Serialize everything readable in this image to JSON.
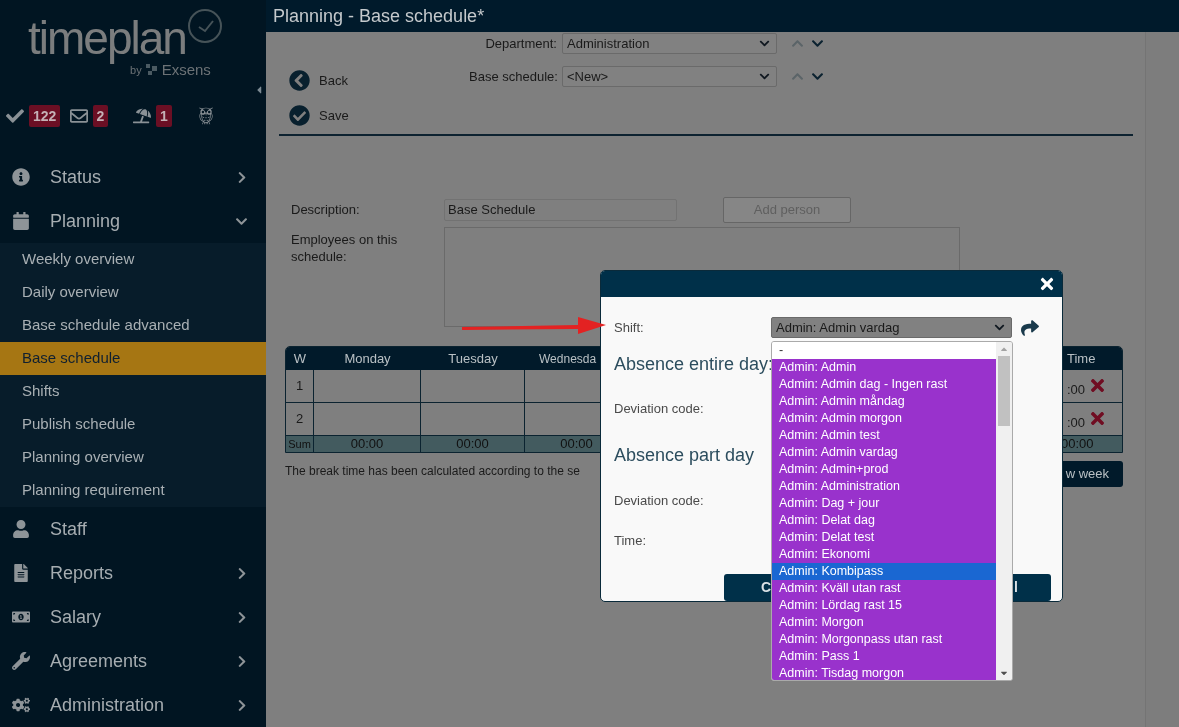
{
  "sidebar": {
    "logo": {
      "name": "timeplan",
      "byline": "by",
      "brand": "Exsens"
    },
    "badges": [
      {
        "kind": "tasks",
        "count": "122"
      },
      {
        "kind": "messages",
        "count": "2"
      },
      {
        "kind": "vacation",
        "count": "1"
      },
      {
        "kind": "owl"
      }
    ],
    "menu": [
      {
        "kind": "status",
        "label": "Status",
        "expanded": false
      },
      {
        "kind": "planning",
        "label": "Planning",
        "expanded": true,
        "children": [
          {
            "label": "Weekly overview",
            "selected": false
          },
          {
            "label": "Daily overview",
            "selected": false
          },
          {
            "label": "Base schedule advanced",
            "selected": false
          },
          {
            "label": "Base schedule",
            "selected": true
          },
          {
            "label": "Shifts",
            "selected": false
          },
          {
            "label": "Publish schedule",
            "selected": false
          },
          {
            "label": "Planning overview",
            "selected": false
          },
          {
            "label": "Planning requirement",
            "selected": false
          }
        ]
      },
      {
        "kind": "staff",
        "label": "Staff"
      },
      {
        "kind": "reports",
        "label": "Reports",
        "expanded": false
      },
      {
        "kind": "salary",
        "label": "Salary",
        "expanded": false
      },
      {
        "kind": "agreements",
        "label": "Agreements",
        "expanded": false
      },
      {
        "kind": "administration",
        "label": "Administration",
        "expanded": false
      }
    ]
  },
  "page_title": "Planning - Base schedule*",
  "filters": [
    {
      "label": "Department:",
      "value": "Administration"
    },
    {
      "label": "Base schedule:",
      "value": "<New>"
    }
  ],
  "actions": [
    {
      "kind": "back",
      "label": "Back"
    },
    {
      "kind": "save",
      "label": "Save"
    }
  ],
  "form": {
    "description_label": "Description:",
    "description_value": "Base Schedule",
    "add_person": {
      "label": "Add person",
      "disabled": true
    },
    "employees_label": "Employees on this schedule:"
  },
  "schedule_table": {
    "columns": [
      "W",
      "Monday",
      "Tuesday",
      "Wednesda"
    ],
    "time_column": "Time",
    "rows": [
      {
        "week": "1",
        "time": ":00"
      },
      {
        "week": "2",
        "time": ":00"
      }
    ],
    "sum": {
      "label": "Sum",
      "values": [
        "00:00",
        "00:00",
        "00:00"
      ],
      "time": "00:00"
    }
  },
  "note": "The break time has been calculated according to the se",
  "new_week_button": "w week",
  "dialog": {
    "shift_label": "Shift:",
    "shift_value": "Admin: Admin vardag",
    "absence_entire_day": "Absence entire day:",
    "deviation_code_1": "Deviation code:",
    "absence_part_day": "Absence part day",
    "deviation_code_2": "Deviation code:",
    "time_label": "Time:",
    "buttons": [
      "C",
      "l"
    ],
    "options": [
      {
        "label": "-",
        "selected": false
      },
      {
        "label": "Admin: Admin",
        "selected": false
      },
      {
        "label": "Admin: Admin dag - Ingen rast",
        "selected": false
      },
      {
        "label": "Admin: Admin måndag",
        "selected": false
      },
      {
        "label": "Admin: Admin morgon",
        "selected": false
      },
      {
        "label": "Admin: Admin test",
        "selected": false
      },
      {
        "label": "Admin: Admin vardag",
        "selected": false
      },
      {
        "label": "Admin: Admin+prod",
        "selected": false
      },
      {
        "label": "Admin: Administration",
        "selected": false
      },
      {
        "label": "Admin: Dag + jour",
        "selected": false
      },
      {
        "label": "Admin: Delat dag",
        "selected": false
      },
      {
        "label": "Admin: Delat test",
        "selected": false
      },
      {
        "label": "Admin: Ekonomi",
        "selected": false
      },
      {
        "label": "Admin: Kombipass",
        "selected": true
      },
      {
        "label": "Admin: Kväll utan rast",
        "selected": false
      },
      {
        "label": "Admin: Lördag rast 15",
        "selected": false
      },
      {
        "label": "Admin: Morgon",
        "selected": false
      },
      {
        "label": "Admin: Morgonpass utan rast",
        "selected": false
      },
      {
        "label": "Admin: Pass 1",
        "selected": false
      },
      {
        "label": "Admin: Tisdag morgon",
        "selected": false
      }
    ]
  }
}
